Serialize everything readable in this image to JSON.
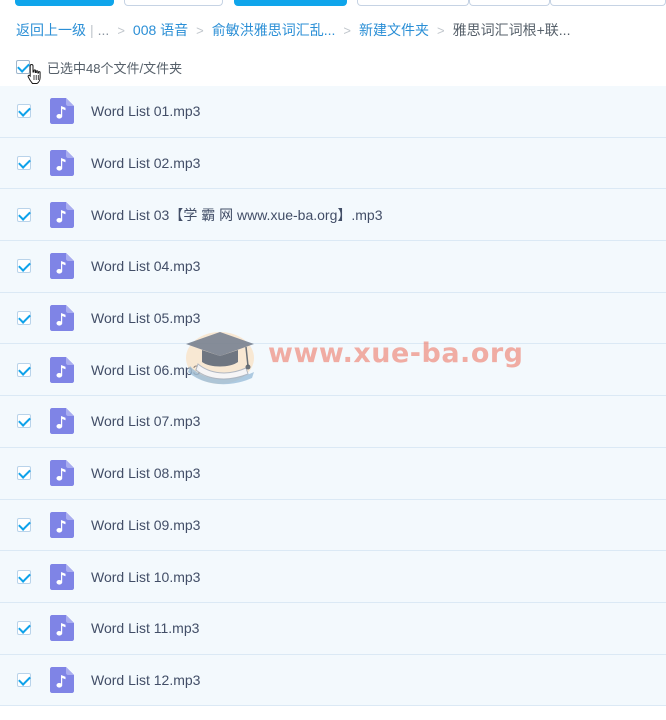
{
  "breadcrumb": {
    "back": "返回上一级",
    "ellipsis": "...",
    "items": [
      "008 语音",
      "俞敏洪雅思词汇乱...",
      "新建文件夹"
    ],
    "current": "雅思词汇词根+联..."
  },
  "selection": {
    "label": "已选中48个文件/文件夹",
    "checked": true
  },
  "files": [
    {
      "name": "Word List 01.mp3",
      "checked": true,
      "icon": "music-file-icon"
    },
    {
      "name": "Word List 02.mp3",
      "checked": true,
      "icon": "music-file-icon"
    },
    {
      "name": "Word List 03【学 霸 网 www.xue-ba.org】.mp3",
      "checked": true,
      "icon": "music-file-icon"
    },
    {
      "name": "Word List 04.mp3",
      "checked": true,
      "icon": "music-file-icon"
    },
    {
      "name": "Word List 05.mp3",
      "checked": true,
      "icon": "music-file-icon"
    },
    {
      "name": "Word List 06.mp3",
      "checked": true,
      "icon": "music-file-icon"
    },
    {
      "name": "Word List 07.mp3",
      "checked": true,
      "icon": "music-file-icon"
    },
    {
      "name": "Word List 08.mp3",
      "checked": true,
      "icon": "music-file-icon"
    },
    {
      "name": "Word List 09.mp3",
      "checked": true,
      "icon": "music-file-icon"
    },
    {
      "name": "Word List 10.mp3",
      "checked": true,
      "icon": "music-file-icon"
    },
    {
      "name": "Word List 11.mp3",
      "checked": true,
      "icon": "music-file-icon"
    },
    {
      "name": "Word List 12.mp3",
      "checked": true,
      "icon": "music-file-icon"
    }
  ],
  "watermark": {
    "text": "www.xue-ba.org"
  },
  "colors": {
    "accent": "#0fa5eb",
    "link": "#2b8fd6",
    "file_icon": "#7f84e6",
    "row_bg": "#f3f9fd",
    "row_border": "#dbe9f5"
  }
}
